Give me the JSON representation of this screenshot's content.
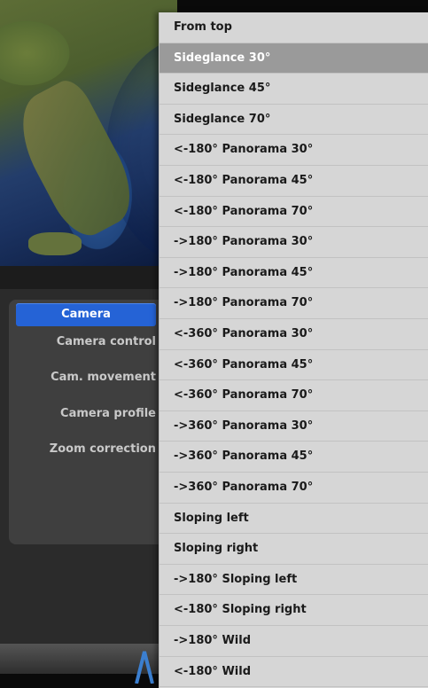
{
  "sidebar": {
    "active_tab": "Camera",
    "items": [
      "Camera control",
      "Cam. movement",
      "Camera profile",
      "Zoom correction"
    ]
  },
  "dropdown": {
    "selected_index": 1,
    "options": [
      "From top",
      "Sideglance 30°",
      "Sideglance 45°",
      "Sideglance 70°",
      "<-180° Panorama 30°",
      "<-180° Panorama 45°",
      "<-180° Panorama 70°",
      "->180° Panorama 30°",
      "->180° Panorama 45°",
      "->180° Panorama 70°",
      "<-360° Panorama 30°",
      "<-360° Panorama 45°",
      "<-360° Panorama 70°",
      "->360° Panorama 30°",
      "->360° Panorama 45°",
      "->360° Panorama 70°",
      "Sloping left",
      "Sloping right",
      "->180° Sloping left",
      "<-180° Sloping right",
      "->180° Wild",
      "<-180° Wild"
    ]
  },
  "colors": {
    "accent": "#2563d6",
    "dropdown_bg": "#d6d6d6",
    "selected_bg": "#9a9a9a"
  }
}
